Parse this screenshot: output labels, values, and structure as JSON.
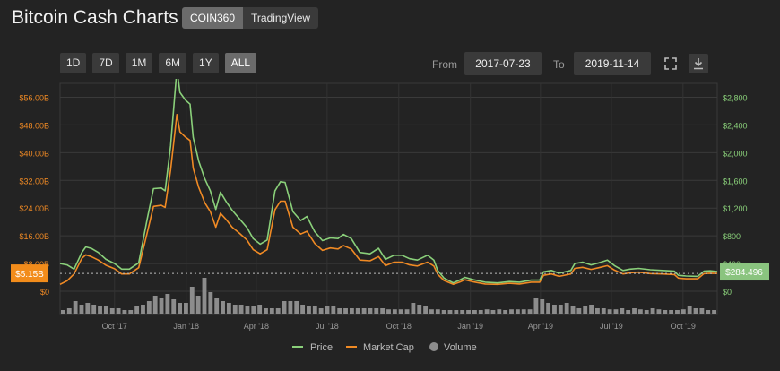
{
  "header": {
    "title": "Bitcoin Cash Charts",
    "sources": [
      "COIN360",
      "TradingView"
    ],
    "active_source": "COIN360"
  },
  "range_buttons": [
    "1D",
    "7D",
    "1M",
    "6M",
    "1Y",
    "ALL"
  ],
  "active_range": "ALL",
  "date_range": {
    "from_label": "From",
    "from": "2017-07-23",
    "to_label": "To",
    "to": "2019-11-14"
  },
  "icons": {
    "fullscreen": "fullscreen-icon",
    "download": "download-icon"
  },
  "chart_data": {
    "type": "line",
    "left_axis": {
      "ticks": [
        "$0",
        "$8.00B",
        "$16.00B",
        "$24.00B",
        "$32.00B",
        "$40.00B",
        "$48.00B",
        "$56.00B"
      ],
      "range": [
        0,
        60
      ],
      "unit": "B"
    },
    "right_axis": {
      "ticks": [
        "$0",
        "$400",
        "$800",
        "$1,200",
        "$1,600",
        "$2,000",
        "$2,400",
        "$2,800"
      ],
      "range": [
        0,
        3000
      ]
    },
    "x_ticks": [
      "Oct '17",
      "Jan '18",
      "Apr '18",
      "Jul '18",
      "Oct '18",
      "Jan '19",
      "Apr '19",
      "Jul '19",
      "Oct '19"
    ],
    "x_range": [
      "2017-07-23",
      "2019-11-14"
    ],
    "current_market_cap_label": "$5.15B",
    "current_price_label": "$284.496",
    "colors": {
      "price": "#8ad07a",
      "market_cap": "#f08a24",
      "volume": "#8c8c8c",
      "left_axis": "#f08a24",
      "right_axis": "#8ad07a",
      "price_tag_bg": "#8ac47f",
      "cap_tag_bg": "#f28c1b"
    },
    "series": [
      {
        "name": "Price",
        "points": [
          [
            "2017-07-23",
            400
          ],
          [
            "2017-08-01",
            380
          ],
          [
            "2017-08-10",
            320
          ],
          [
            "2017-08-20",
            560
          ],
          [
            "2017-08-25",
            640
          ],
          [
            "2017-09-01",
            620
          ],
          [
            "2017-09-10",
            560
          ],
          [
            "2017-09-20",
            460
          ],
          [
            "2017-10-01",
            400
          ],
          [
            "2017-10-10",
            320
          ],
          [
            "2017-10-20",
            320
          ],
          [
            "2017-11-01",
            410
          ],
          [
            "2017-11-12",
            1050
          ],
          [
            "2017-11-20",
            1480
          ],
          [
            "2017-11-30",
            1490
          ],
          [
            "2017-12-05",
            1450
          ],
          [
            "2017-12-12",
            2100
          ],
          [
            "2017-12-20",
            3200
          ],
          [
            "2017-12-24",
            2870
          ],
          [
            "2017-12-31",
            2760
          ],
          [
            "2018-01-06",
            2700
          ],
          [
            "2018-01-10",
            2220
          ],
          [
            "2018-01-17",
            1880
          ],
          [
            "2018-01-25",
            1620
          ],
          [
            "2018-02-01",
            1450
          ],
          [
            "2018-02-08",
            1180
          ],
          [
            "2018-02-14",
            1430
          ],
          [
            "2018-02-22",
            1280
          ],
          [
            "2018-03-01",
            1170
          ],
          [
            "2018-03-10",
            1050
          ],
          [
            "2018-03-20",
            920
          ],
          [
            "2018-03-28",
            760
          ],
          [
            "2018-04-06",
            680
          ],
          [
            "2018-04-15",
            740
          ],
          [
            "2018-04-25",
            1450
          ],
          [
            "2018-05-02",
            1580
          ],
          [
            "2018-05-08",
            1570
          ],
          [
            "2018-05-18",
            1150
          ],
          [
            "2018-05-28",
            1020
          ],
          [
            "2018-06-05",
            1080
          ],
          [
            "2018-06-15",
            860
          ],
          [
            "2018-06-25",
            730
          ],
          [
            "2018-07-05",
            770
          ],
          [
            "2018-07-15",
            760
          ],
          [
            "2018-07-22",
            820
          ],
          [
            "2018-08-01",
            760
          ],
          [
            "2018-08-12",
            560
          ],
          [
            "2018-08-25",
            540
          ],
          [
            "2018-09-05",
            620
          ],
          [
            "2018-09-14",
            460
          ],
          [
            "2018-09-25",
            520
          ],
          [
            "2018-10-05",
            520
          ],
          [
            "2018-10-15",
            470
          ],
          [
            "2018-10-25",
            450
          ],
          [
            "2018-11-07",
            520
          ],
          [
            "2018-11-15",
            450
          ],
          [
            "2018-11-20",
            300
          ],
          [
            "2018-11-28",
            190
          ],
          [
            "2018-12-10",
            120
          ],
          [
            "2018-12-18",
            160
          ],
          [
            "2018-12-25",
            200
          ],
          [
            "2019-01-05",
            165
          ],
          [
            "2019-01-20",
            130
          ],
          [
            "2019-02-05",
            120
          ],
          [
            "2019-02-20",
            140
          ],
          [
            "2019-03-05",
            130
          ],
          [
            "2019-03-20",
            160
          ],
          [
            "2019-03-31",
            160
          ],
          [
            "2019-04-05",
            280
          ],
          [
            "2019-04-15",
            300
          ],
          [
            "2019-04-25",
            260
          ],
          [
            "2019-05-10",
            300
          ],
          [
            "2019-05-15",
            400
          ],
          [
            "2019-05-25",
            420
          ],
          [
            "2019-06-05",
            380
          ],
          [
            "2019-06-15",
            410
          ],
          [
            "2019-06-26",
            450
          ],
          [
            "2019-07-05",
            370
          ],
          [
            "2019-07-16",
            300
          ],
          [
            "2019-07-25",
            320
          ],
          [
            "2019-08-05",
            330
          ],
          [
            "2019-08-20",
            310
          ],
          [
            "2019-09-05",
            300
          ],
          [
            "2019-09-20",
            290
          ],
          [
            "2019-09-25",
            230
          ],
          [
            "2019-10-05",
            220
          ],
          [
            "2019-10-20",
            215
          ],
          [
            "2019-10-28",
            290
          ],
          [
            "2019-11-05",
            295
          ],
          [
            "2019-11-14",
            284
          ]
        ]
      },
      {
        "name": "Market Cap",
        "points": [
          [
            "2017-07-23",
            2.0
          ],
          [
            "2017-08-01",
            3.0
          ],
          [
            "2017-08-10",
            5.0
          ],
          [
            "2017-08-20",
            9.5
          ],
          [
            "2017-08-25",
            10.5
          ],
          [
            "2017-09-01",
            10.0
          ],
          [
            "2017-09-10",
            9.0
          ],
          [
            "2017-09-20",
            7.5
          ],
          [
            "2017-10-01",
            6.5
          ],
          [
            "2017-10-10",
            5.0
          ],
          [
            "2017-10-20",
            5.0
          ],
          [
            "2017-11-01",
            6.8
          ],
          [
            "2017-11-12",
            17.0
          ],
          [
            "2017-11-20",
            24.5
          ],
          [
            "2017-11-30",
            24.8
          ],
          [
            "2017-12-05",
            24.2
          ],
          [
            "2017-12-12",
            35.0
          ],
          [
            "2017-12-20",
            51.0
          ],
          [
            "2017-12-24",
            46.0
          ],
          [
            "2017-12-31",
            44.5
          ],
          [
            "2018-01-06",
            43.5
          ],
          [
            "2018-01-10",
            35.5
          ],
          [
            "2018-01-17",
            30.0
          ],
          [
            "2018-01-25",
            25.5
          ],
          [
            "2018-02-01",
            23.0
          ],
          [
            "2018-02-08",
            18.5
          ],
          [
            "2018-02-14",
            22.5
          ],
          [
            "2018-02-22",
            20.5
          ],
          [
            "2018-03-01",
            18.5
          ],
          [
            "2018-03-10",
            16.8
          ],
          [
            "2018-03-20",
            14.8
          ],
          [
            "2018-03-28",
            12.0
          ],
          [
            "2018-04-06",
            10.8
          ],
          [
            "2018-04-15",
            12.0
          ],
          [
            "2018-04-25",
            23.5
          ],
          [
            "2018-05-02",
            26.0
          ],
          [
            "2018-05-08",
            26.0
          ],
          [
            "2018-05-18",
            18.5
          ],
          [
            "2018-05-28",
            16.5
          ],
          [
            "2018-06-05",
            17.3
          ],
          [
            "2018-06-15",
            13.8
          ],
          [
            "2018-06-25",
            11.8
          ],
          [
            "2018-07-05",
            12.5
          ],
          [
            "2018-07-15",
            12.2
          ],
          [
            "2018-07-22",
            13.2
          ],
          [
            "2018-08-01",
            12.2
          ],
          [
            "2018-08-12",
            9.0
          ],
          [
            "2018-08-25",
            8.8
          ],
          [
            "2018-09-05",
            10.0
          ],
          [
            "2018-09-14",
            7.4
          ],
          [
            "2018-09-25",
            8.4
          ],
          [
            "2018-10-05",
            8.4
          ],
          [
            "2018-10-15",
            7.6
          ],
          [
            "2018-10-25",
            7.3
          ],
          [
            "2018-11-07",
            8.4
          ],
          [
            "2018-11-15",
            7.3
          ],
          [
            "2018-11-20",
            4.9
          ],
          [
            "2018-11-28",
            3.1
          ],
          [
            "2018-12-10",
            2.0
          ],
          [
            "2018-12-18",
            2.6
          ],
          [
            "2018-12-25",
            3.3
          ],
          [
            "2019-01-05",
            2.7
          ],
          [
            "2019-01-20",
            2.1
          ],
          [
            "2019-02-05",
            2.0
          ],
          [
            "2019-02-20",
            2.3
          ],
          [
            "2019-03-05",
            2.1
          ],
          [
            "2019-03-20",
            2.6
          ],
          [
            "2019-03-31",
            2.6
          ],
          [
            "2019-04-05",
            4.6
          ],
          [
            "2019-04-15",
            5.0
          ],
          [
            "2019-04-25",
            4.3
          ],
          [
            "2019-05-10",
            5.0
          ],
          [
            "2019-05-15",
            6.6
          ],
          [
            "2019-05-25",
            6.9
          ],
          [
            "2019-06-05",
            6.3
          ],
          [
            "2019-06-15",
            6.8
          ],
          [
            "2019-06-26",
            7.4
          ],
          [
            "2019-07-05",
            6.1
          ],
          [
            "2019-07-16",
            5.0
          ],
          [
            "2019-07-25",
            5.3
          ],
          [
            "2019-08-05",
            5.5
          ],
          [
            "2019-08-20",
            5.1
          ],
          [
            "2019-09-05",
            5.0
          ],
          [
            "2019-09-20",
            4.8
          ],
          [
            "2019-09-25",
            3.8
          ],
          [
            "2019-10-05",
            3.6
          ],
          [
            "2019-10-20",
            3.6
          ],
          [
            "2019-10-28",
            5.1
          ],
          [
            "2019-11-05",
            5.2
          ],
          [
            "2019-11-14",
            5.15
          ]
        ]
      },
      {
        "name": "Volume",
        "relative_heights": [
          0.1,
          0.15,
          0.35,
          0.25,
          0.3,
          0.25,
          0.2,
          0.2,
          0.15,
          0.15,
          0.1,
          0.1,
          0.2,
          0.25,
          0.35,
          0.5,
          0.45,
          0.55,
          0.4,
          0.3,
          0.3,
          0.75,
          0.5,
          1.0,
          0.6,
          0.45,
          0.35,
          0.3,
          0.25,
          0.25,
          0.2,
          0.2,
          0.25,
          0.15,
          0.15,
          0.15,
          0.35,
          0.35,
          0.35,
          0.25,
          0.2,
          0.2,
          0.15,
          0.2,
          0.2,
          0.15,
          0.15,
          0.15,
          0.15,
          0.15,
          0.15,
          0.15,
          0.15,
          0.12,
          0.12,
          0.12,
          0.12,
          0.3,
          0.25,
          0.2,
          0.12,
          0.12,
          0.1,
          0.1,
          0.1,
          0.1,
          0.1,
          0.1,
          0.1,
          0.12,
          0.1,
          0.12,
          0.1,
          0.12,
          0.12,
          0.12,
          0.12,
          0.45,
          0.4,
          0.3,
          0.25,
          0.25,
          0.3,
          0.2,
          0.15,
          0.2,
          0.25,
          0.15,
          0.15,
          0.12,
          0.12,
          0.15,
          0.1,
          0.15,
          0.12,
          0.1,
          0.15,
          0.12,
          0.1,
          0.1,
          0.1,
          0.12,
          0.2,
          0.15,
          0.15,
          0.1,
          0.1
        ]
      }
    ],
    "legend": [
      "Price",
      "Market Cap",
      "Volume"
    ],
    "legend_position": "bottom",
    "grid": true
  }
}
